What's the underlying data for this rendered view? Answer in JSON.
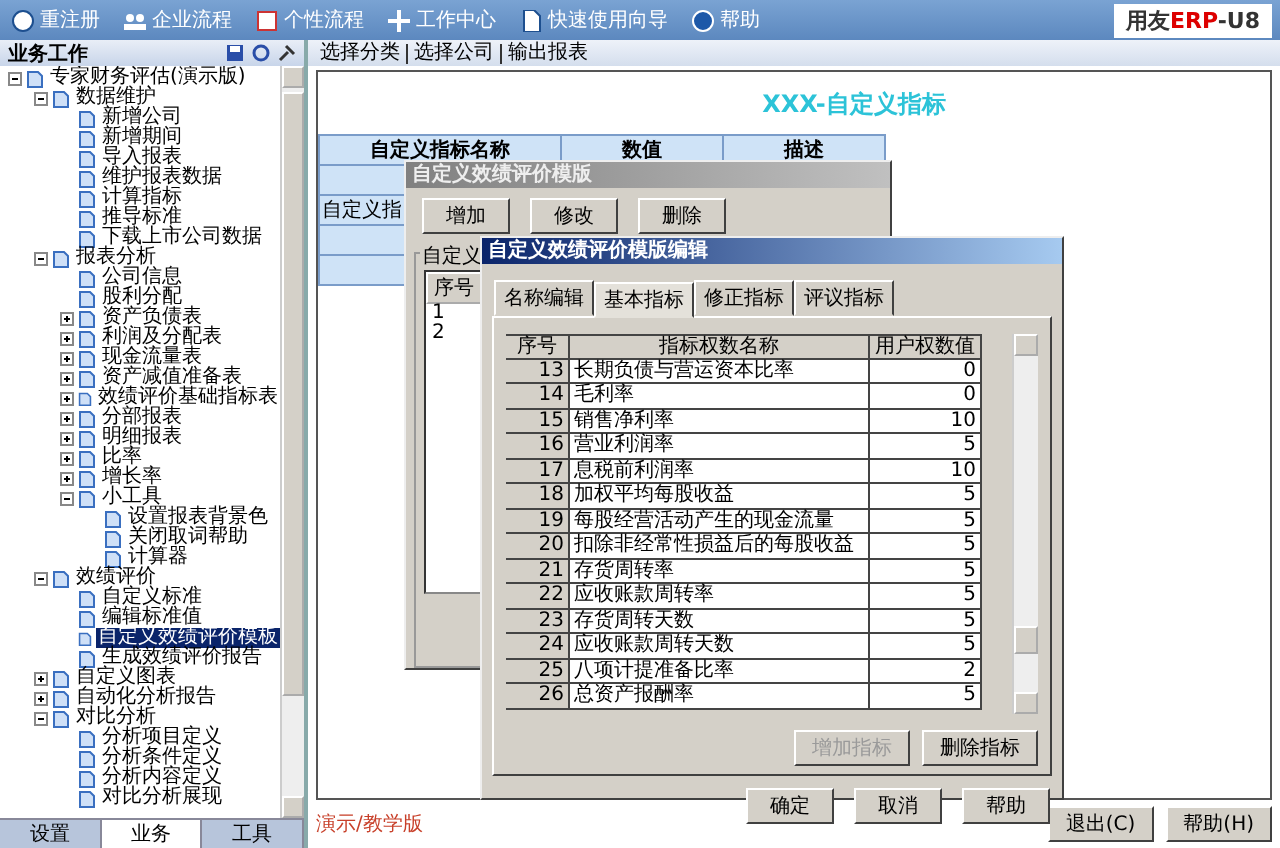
{
  "toolbar": [
    {
      "label": "重注册"
    },
    {
      "label": "企业流程"
    },
    {
      "label": "个性流程"
    },
    {
      "label": "工作中心"
    },
    {
      "label": "快速使用向导"
    },
    {
      "label": "帮助"
    }
  ],
  "logo": {
    "brand": "用友",
    "red": "ERP",
    "suffix": "-U8"
  },
  "sidebar": {
    "title": "业务工作",
    "tree": [
      {
        "label": "专家财务评估(演示版)",
        "expanded": true,
        "selected": false,
        "children": [
          {
            "label": "数据维护",
            "expanded": true,
            "selected": false,
            "children": [
              {
                "label": "新增公司",
                "selected": false
              },
              {
                "label": "新增期间",
                "selected": false
              },
              {
                "label": "导入报表",
                "selected": false
              },
              {
                "label": "维护报表数据",
                "selected": false
              },
              {
                "label": "计算指标",
                "selected": false
              },
              {
                "label": "推导标准",
                "selected": false
              },
              {
                "label": "下载上市公司数据",
                "selected": false
              }
            ]
          },
          {
            "label": "报表分析",
            "expanded": true,
            "selected": false,
            "children": [
              {
                "label": "公司信息",
                "selected": false
              },
              {
                "label": "股利分配",
                "selected": false
              },
              {
                "label": "资产负债表",
                "expanded": false,
                "selected": false
              },
              {
                "label": "利润及分配表",
                "expanded": false,
                "selected": false
              },
              {
                "label": "现金流量表",
                "expanded": false,
                "selected": false
              },
              {
                "label": "资产减值准备表",
                "expanded": false,
                "selected": false
              },
              {
                "label": "效绩评价基础指标表",
                "expanded": false,
                "selected": false
              },
              {
                "label": "分部报表",
                "expanded": false,
                "selected": false
              },
              {
                "label": "明细报表",
                "expanded": false,
                "selected": false
              },
              {
                "label": "比率",
                "expanded": false,
                "selected": false
              },
              {
                "label": "增长率",
                "expanded": false,
                "selected": false
              },
              {
                "label": "小工具",
                "expanded": true,
                "selected": false,
                "children": [
                  {
                    "label": "设置报表背景色",
                    "selected": false
                  },
                  {
                    "label": "关闭取词帮助",
                    "selected": false
                  },
                  {
                    "label": "计算器",
                    "selected": false
                  }
                ]
              }
            ]
          },
          {
            "label": "效绩评价",
            "expanded": true,
            "selected": false,
            "children": [
              {
                "label": "自定义标准",
                "selected": false
              },
              {
                "label": "编辑标准值",
                "selected": false
              },
              {
                "label": "自定义效绩评价模板",
                "selected": true
              },
              {
                "label": "生成效绩评价报告",
                "selected": false
              }
            ]
          },
          {
            "label": "自定义图表",
            "expanded": false,
            "selected": false
          },
          {
            "label": "自动化分析报告",
            "expanded": false,
            "selected": false
          },
          {
            "label": "对比分析",
            "expanded": true,
            "selected": false,
            "children": [
              {
                "label": "分析项目定义",
                "selected": false
              },
              {
                "label": "分析条件定义",
                "selected": false
              },
              {
                "label": "分析内容定义",
                "selected": false
              },
              {
                "label": "对比分析展现",
                "selected": false
              }
            ]
          }
        ]
      }
    ],
    "tabs": [
      {
        "label": "设置",
        "selected": false
      },
      {
        "label": "业务",
        "selected": true
      },
      {
        "label": "工具",
        "selected": false
      }
    ]
  },
  "breadcrumb": [
    "选择分类",
    "选择公司",
    "输出报表"
  ],
  "report": {
    "title": "XXX-自定义指标",
    "columns": [
      "自定义指标名称",
      "数值",
      "描述"
    ],
    "row_label": "自定义指"
  },
  "footer": {
    "edition": "演示/教学版",
    "buttons": [
      "退出(C)",
      "帮助(H)"
    ]
  },
  "template_dialog": {
    "title": "自定义效绩评价模版",
    "buttons": [
      "增加",
      "修改",
      "删除"
    ],
    "group": "自定义",
    "list_header": "序号",
    "list_rows": [
      "1",
      "2"
    ]
  },
  "edit_dialog": {
    "title": "自定义效绩评价模版编辑",
    "tabs": [
      {
        "label": "名称编辑",
        "selected": false
      },
      {
        "label": "基本指标",
        "selected": true
      },
      {
        "label": "修正指标",
        "selected": false
      },
      {
        "label": "评议指标",
        "selected": false
      }
    ],
    "columns": [
      "序号",
      "指标权数名称",
      "用户权数值"
    ],
    "rows": [
      {
        "no": "13",
        "name": "长期负债与营运资本比率",
        "value": "0"
      },
      {
        "no": "14",
        "name": "毛利率",
        "value": "0"
      },
      {
        "no": "15",
        "name": "销售净利率",
        "value": "10"
      },
      {
        "no": "16",
        "name": "营业利润率",
        "value": "5"
      },
      {
        "no": "17",
        "name": "息税前利润率",
        "value": "10"
      },
      {
        "no": "18",
        "name": "加权平均每股收益",
        "value": "5"
      },
      {
        "no": "19",
        "name": "每股经营活动产生的现金流量",
        "value": "5"
      },
      {
        "no": "20",
        "name": "扣除非经常性损益后的每股收益",
        "value": "5"
      },
      {
        "no": "21",
        "name": "存货周转率",
        "value": "5"
      },
      {
        "no": "22",
        "name": "应收账款周转率",
        "value": "5"
      },
      {
        "no": "23",
        "name": "存货周转天数",
        "value": "5"
      },
      {
        "no": "24",
        "name": "应收账款周转天数",
        "value": "5"
      },
      {
        "no": "25",
        "name": "八项计提准备比率",
        "value": "2"
      },
      {
        "no": "26",
        "name": "总资产报酬率",
        "value": "5"
      }
    ],
    "panel_buttons": [
      {
        "label": "增加指标",
        "disabled": true
      },
      {
        "label": "删除指标",
        "disabled": false
      }
    ],
    "buttons": [
      "确定",
      "取消",
      "帮助"
    ]
  }
}
